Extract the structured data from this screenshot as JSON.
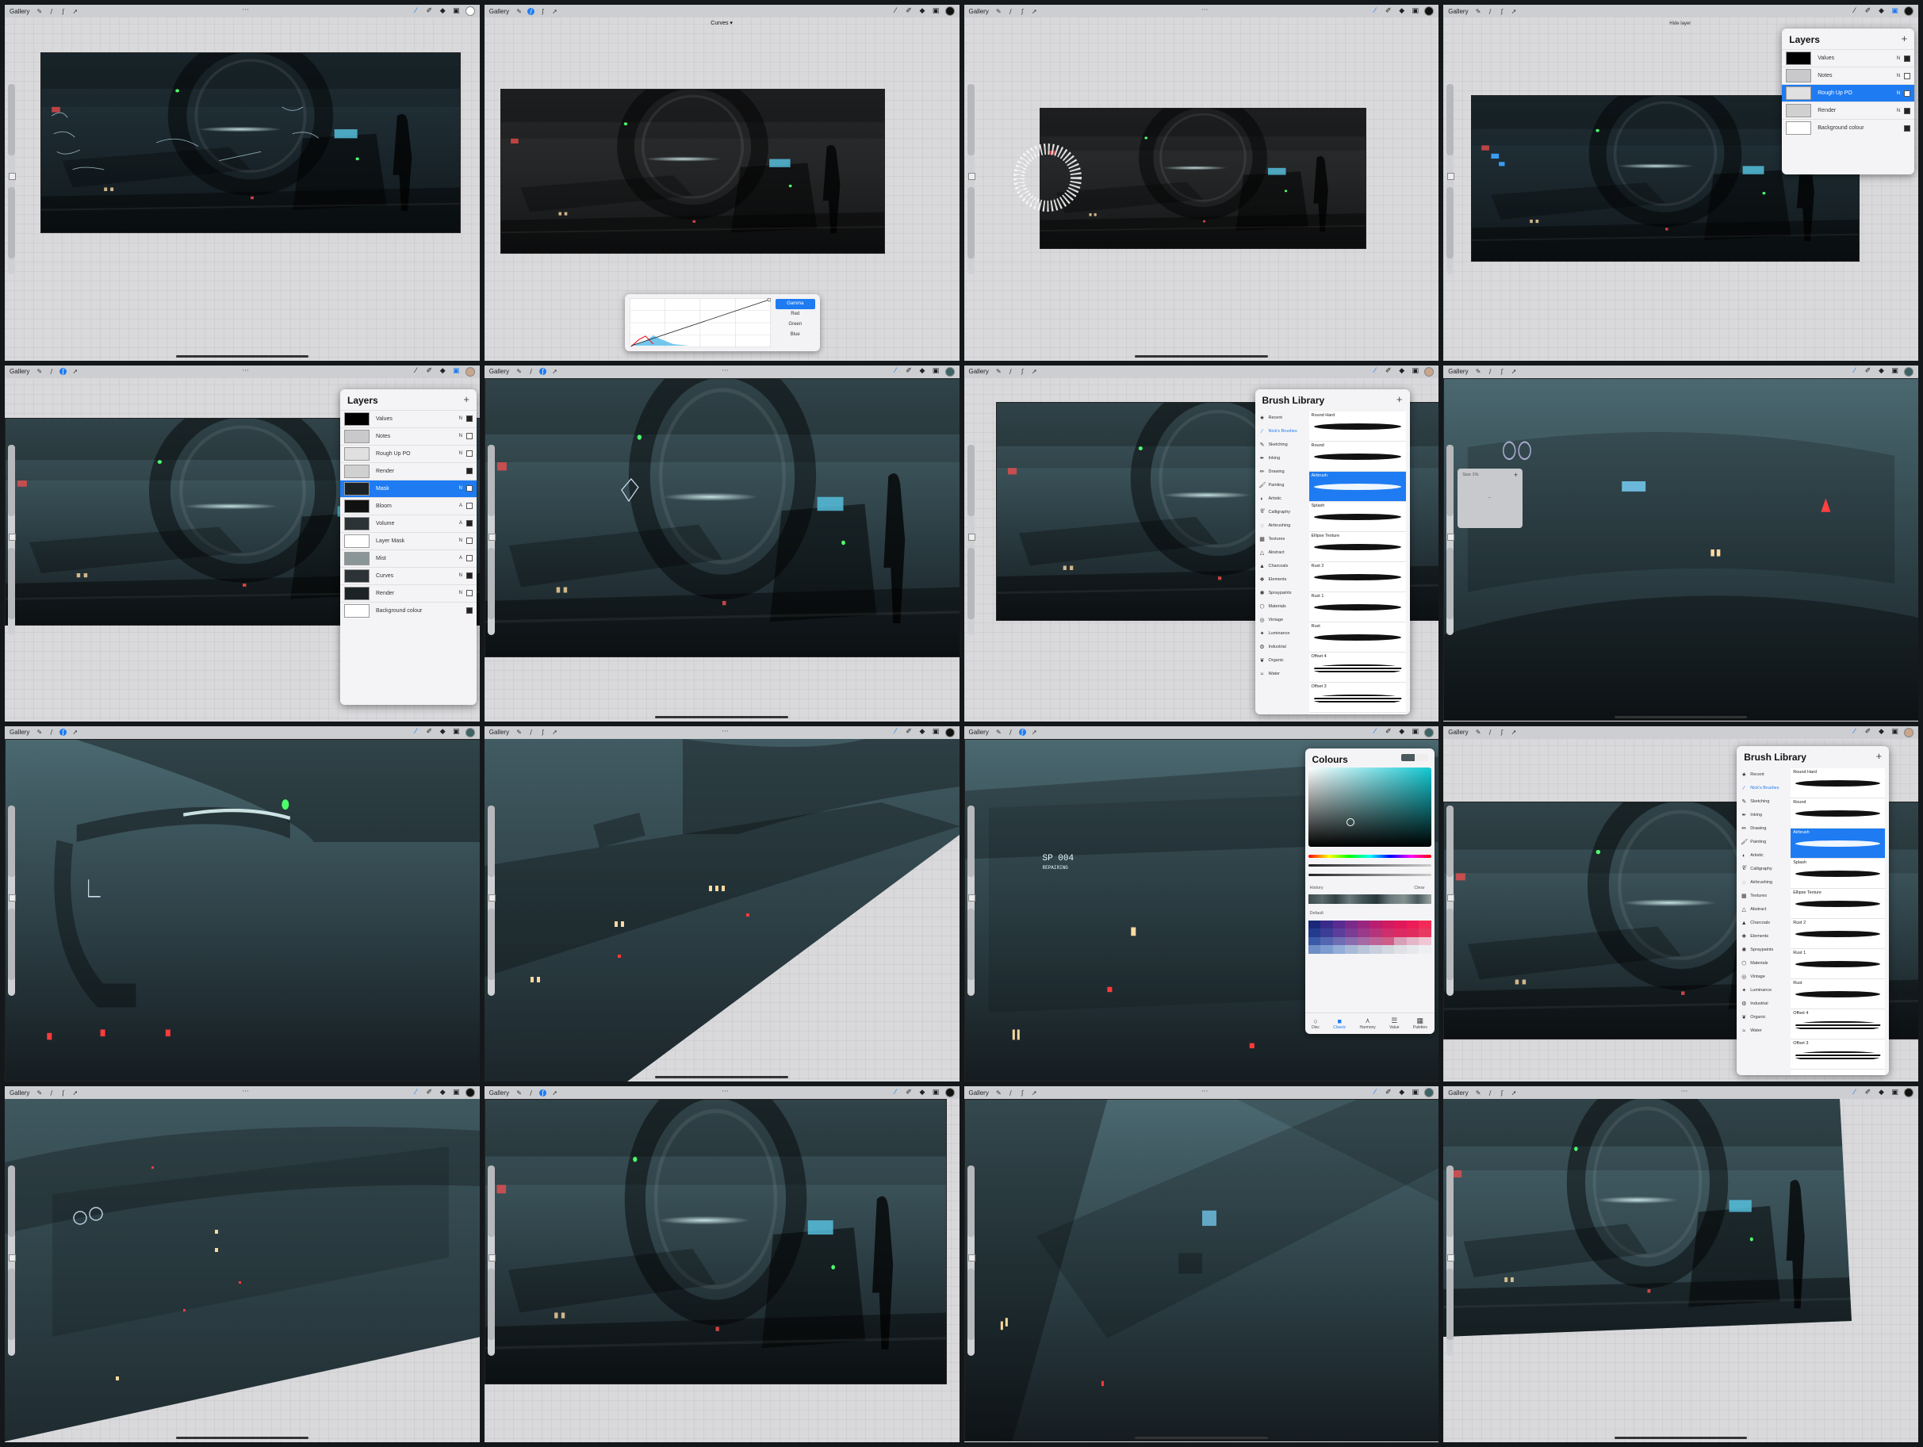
{
  "topbar": {
    "gallery_label": "Gallery",
    "dots": "···"
  },
  "panel2": {
    "adjustment_title": "Curves ▾",
    "curve_options": [
      "Gamma",
      "Red",
      "Green",
      "Blue"
    ],
    "active_option": "Gamma"
  },
  "panel4": {
    "hint_text": "Hide layer"
  },
  "layers_small": {
    "title": "Layers",
    "plus": "+",
    "rows": [
      {
        "name": "Values",
        "mode": "N"
      },
      {
        "name": "Notes",
        "mode": "N"
      },
      {
        "name": "Rough Up PO",
        "mode": "N",
        "active": true
      },
      {
        "name": "Render",
        "mode": "N"
      },
      {
        "name": "Background colour",
        "mode": ""
      }
    ]
  },
  "layers_large": {
    "title": "Layers",
    "plus": "+",
    "rows": [
      {
        "name": "Values",
        "mode": "N"
      },
      {
        "name": "Notes",
        "mode": "N"
      },
      {
        "name": "Rough Up PO",
        "mode": "N"
      },
      {
        "name": "Render",
        "mode": ""
      },
      {
        "name": "Mask",
        "mode": "N",
        "active": true
      },
      {
        "name": "Bloom",
        "mode": "A"
      },
      {
        "name": "Volume",
        "mode": "A"
      },
      {
        "name": "Layer Mask",
        "mode": "N"
      },
      {
        "name": "Mist",
        "mode": "A"
      },
      {
        "name": "Curves",
        "mode": "N"
      },
      {
        "name": "Render",
        "mode": "N"
      },
      {
        "name": "Background colour",
        "mode": ""
      }
    ]
  },
  "brush_library": {
    "title": "Brush Library",
    "plus": "+",
    "categories": [
      "Recent",
      "Nick's Brushes",
      "Sketching",
      "Inking",
      "Drawing",
      "Painting",
      "Artistic",
      "Calligraphy",
      "Airbrushing",
      "Textures",
      "Abstract",
      "Charcoals",
      "Elements",
      "Spraypaints",
      "Materials",
      "Vintage",
      "Luminance",
      "Industrial",
      "Organic",
      "Water"
    ],
    "active_category": "Nick's Brushes",
    "brushes": [
      "Round Hard",
      "Round",
      "Airbrush",
      "Splash",
      "Ellipse Texture",
      "Rust 2",
      "Rust 1",
      "Rust",
      "Offset 4",
      "Offset 3"
    ],
    "active_brush": "Airbrush"
  },
  "size_hud": {
    "label": "Size 1%",
    "plus": "+",
    "minus": "−"
  },
  "colours": {
    "title": "Colours",
    "history_label": "History",
    "clear_label": "Clear",
    "palette_label": "Default",
    "tabs": [
      "Disc",
      "Classic",
      "Harmony",
      "Value",
      "Palettes"
    ],
    "active_tab": "Classic"
  },
  "artwork": {
    "hud_text_1": "SP 004",
    "hud_text_2": "REPAIRING"
  },
  "colors": {
    "accent": "#1e7bf2",
    "scene_dark": "#1c2328",
    "scene_teal": "#3d5a62",
    "canvas_bg": "#d9d9dc"
  }
}
